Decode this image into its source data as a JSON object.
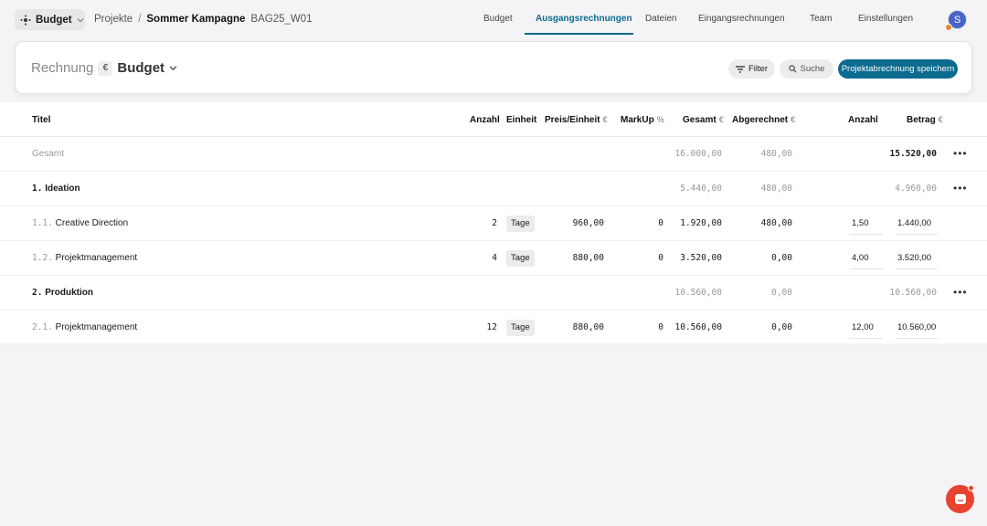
{
  "topbar": {
    "app_label": "Budget",
    "breadcrumb": [
      "Projekte",
      "/",
      "Sommer Kampagne",
      "BAG25_W01"
    ],
    "tabs": [
      "Budget",
      "Ausgangsrechnungen",
      "Dateien",
      "Eingangsrechnungen",
      "Team",
      "Einstellungen"
    ],
    "active_tab": "Ausgangsrechnungen",
    "avatar_initial": "S"
  },
  "header": {
    "title": "Rechnung",
    "currency": "€",
    "budget_label": "Budget",
    "filter_label": "Filter",
    "search_label": "Suche",
    "save_label": "Projektabrechnung speichern"
  },
  "table": {
    "columns": {
      "titel": "Titel",
      "anzahl": "Anzahl",
      "einheit": "Einheit",
      "preis": "Preis/Einheit",
      "preis_unit": "€",
      "markup": "MarkUp",
      "markup_unit": "%",
      "gesamt": "Gesamt",
      "gesamt_unit": "€",
      "abgerechnet": "Abgerechnet",
      "abgerechnet_unit": "€",
      "anzahl2": "Anzahl",
      "betrag": "Betrag",
      "betrag_unit": "€"
    },
    "total": {
      "label": "Gesamt",
      "gesamt": "16.000,00",
      "abgerechnet": "480,00",
      "betrag": "15.520,00"
    },
    "rows": [
      {
        "num": "1.",
        "title": "Ideation",
        "gesamt": "5.440,00",
        "abgerechnet": "480,00",
        "betrag": "4.960,00"
      },
      {
        "num": "1.1.",
        "title": "Creative Direction",
        "anzahl": "2",
        "einheit": "Tage",
        "preis": "960,00",
        "markup": "0",
        "gesamt": "1.920,00",
        "abgerechnet": "480,00",
        "anzahl2": "1,50",
        "betrag": "1.440,00"
      },
      {
        "num": "1.2.",
        "title": "Projektmanagement",
        "anzahl": "4",
        "einheit": "Tage",
        "preis": "880,00",
        "markup": "0",
        "gesamt": "3.520,00",
        "abgerechnet": "0,00",
        "anzahl2": "4,00",
        "betrag": "3.520,00"
      },
      {
        "num": "2.",
        "title": "Produktion",
        "gesamt": "10.560,00",
        "abgerechnet": "0,00",
        "betrag": "10.560,00"
      },
      {
        "num": "2.1.",
        "title": "Projektmanagement",
        "anzahl": "12",
        "einheit": "Tage",
        "preis": "880,00",
        "markup": "0",
        "gesamt": "10.560,00",
        "abgerechnet": "0,00",
        "anzahl2": "12,00",
        "betrag": "10.560,00"
      }
    ],
    "more_glyph": "•••"
  },
  "colors": {
    "accent": "#0b6b8f",
    "chat": "#e8432e",
    "avatar": "#4a64c9"
  }
}
